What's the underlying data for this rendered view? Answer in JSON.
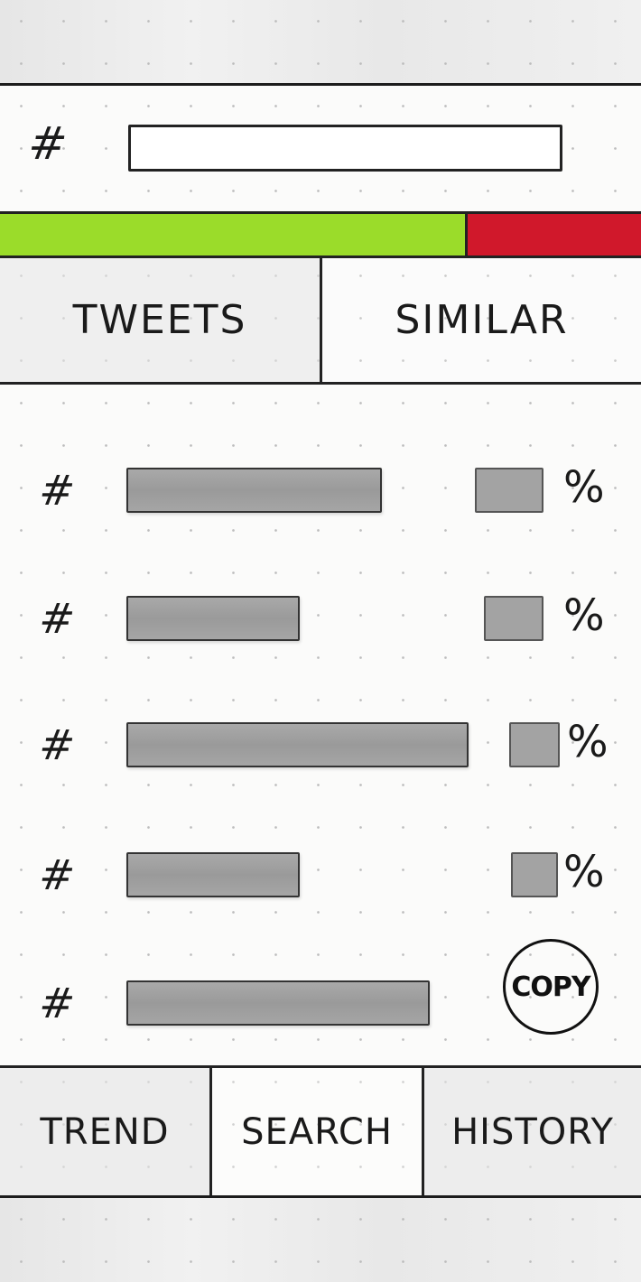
{
  "search": {
    "hash_symbol": "#",
    "value": "",
    "placeholder": ""
  },
  "sentiment": {
    "positive_fraction": 0.73,
    "positive_color": "#9bdc2a",
    "negative_color": "#d0182b"
  },
  "tabs": [
    {
      "label": "TWEETS",
      "active": true
    },
    {
      "label": "SIMILAR",
      "active": false
    }
  ],
  "hashtags": [
    {
      "symbol": "#",
      "bar_fraction": 0.59,
      "percent_sign": "%",
      "percent_level": 0.9
    },
    {
      "symbol": "#",
      "bar_fraction": 0.4,
      "percent_sign": "%",
      "percent_level": 0.6
    },
    {
      "symbol": "#",
      "bar_fraction": 0.79,
      "percent_sign": "%",
      "percent_level": 0.5
    },
    {
      "symbol": "#",
      "bar_fraction": 0.4,
      "percent_sign": "%",
      "percent_level": 0.4
    },
    {
      "symbol": "#",
      "bar_fraction": 0.7
    }
  ],
  "copy_label": "COPY",
  "nav": {
    "trend": "TREND",
    "search": "SEARCH",
    "history": "HISTORY",
    "active": "search"
  }
}
